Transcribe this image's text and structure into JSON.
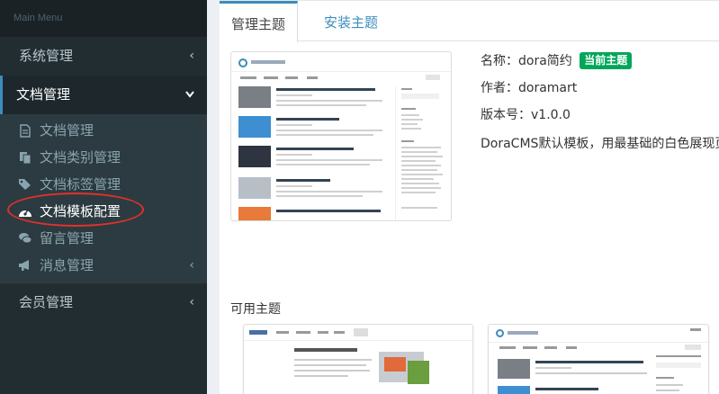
{
  "sidebar": {
    "header": "Main Menu",
    "items": [
      {
        "label": "系统管理"
      },
      {
        "label": "文档管理"
      },
      {
        "label": "会员管理"
      }
    ],
    "submenu": [
      {
        "label": "文档管理",
        "icon": "file-icon"
      },
      {
        "label": "文档类别管理",
        "icon": "files-icon"
      },
      {
        "label": "文档标签管理",
        "icon": "tags-icon"
      },
      {
        "label": "文档模板配置",
        "icon": "dashboard-icon"
      },
      {
        "label": "留言管理",
        "icon": "comments-icon"
      },
      {
        "label": "消息管理",
        "icon": "bullhorn-icon"
      }
    ]
  },
  "tabs": {
    "manage": "管理主题",
    "install": "安装主题"
  },
  "current_theme": {
    "name_label": "名称：",
    "name": "dora简约",
    "badge": "当前主题",
    "author_label": "作者：",
    "author": "doramart",
    "version_label": "版本号：",
    "version": "v1.0.0",
    "description": "DoraCMS默认模板，用最基础的白色展现页面"
  },
  "available": {
    "title": "可用主题"
  },
  "colors": {
    "sidebar": "#222d32",
    "accent": "#3c8dbc",
    "badge": "#00a65a",
    "highlight": "#e0322b"
  }
}
